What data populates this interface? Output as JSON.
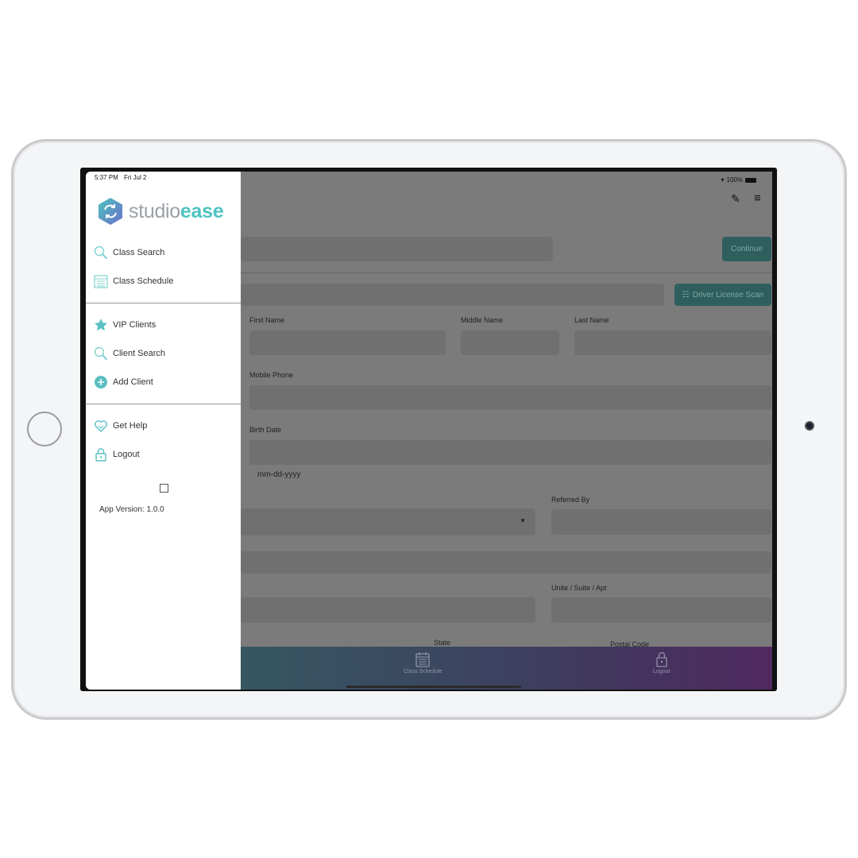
{
  "status": {
    "time": "5:37 PM",
    "date": "Fri Jul 2",
    "battery": "100%"
  },
  "brand": {
    "part1": "studio",
    "part2": "ease"
  },
  "drawer": {
    "groups": [
      [
        {
          "label": "Class Search",
          "icon": "magnifier-icon"
        },
        {
          "label": "Class Schedule",
          "icon": "calendar-icon"
        }
      ],
      [
        {
          "label": "VIP Clients",
          "icon": "star-icon"
        },
        {
          "label": "Client Search",
          "icon": "magnifier-icon"
        },
        {
          "label": "Add Client",
          "icon": "plus-circle-icon"
        }
      ],
      [
        {
          "label": "Get Help",
          "icon": "heart-handshake-icon"
        },
        {
          "label": "Logout",
          "icon": "lock-icon"
        }
      ]
    ],
    "app_version": "App Version: 1.0.0"
  },
  "form": {
    "continue": "Continue",
    "scan": "Driver License Scan",
    "first_name": "First Name",
    "middle_name": "Middle Name",
    "last_name": "Last Name",
    "mobile_phone": "Mobile Phone",
    "birth_date": "Birth Date",
    "date_hint": "mm-dd-yyyy",
    "referred_by": "Referred By",
    "unit": "Unite / Suite / Apt",
    "state": "State",
    "postal": "Postal Code"
  },
  "tabs": [
    {
      "label": "Class Schedule",
      "icon": "calendar-icon"
    },
    {
      "label": "Logout",
      "icon": "lock-icon"
    }
  ],
  "colors": {
    "accent": "#4ec3c0",
    "overlay": "#7b7b7b"
  }
}
